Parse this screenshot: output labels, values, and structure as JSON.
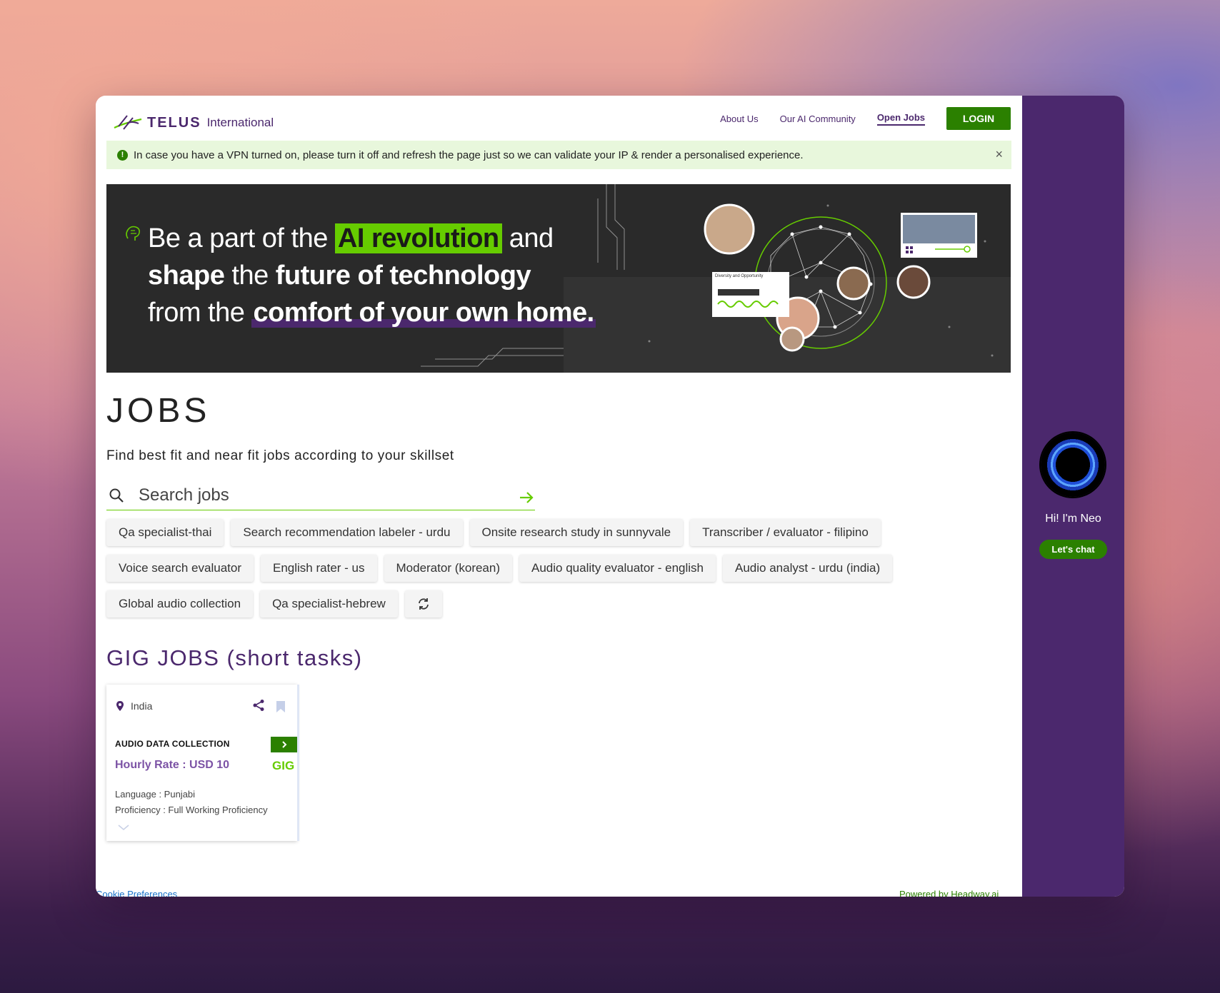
{
  "header": {
    "logo_word": "TELUS",
    "logo_sub": "International",
    "nav": [
      {
        "label": "About Us"
      },
      {
        "label": "Our AI Community"
      },
      {
        "label": "Open Jobs"
      }
    ],
    "login": "LOGIN"
  },
  "alert": {
    "text": "In case you have a VPN turned on, please turn it off and refresh the page just so we can validate your IP & render a personalised experience.",
    "icon": "!",
    "close": "×"
  },
  "banner": {
    "line1_pre": "Be a part of the ",
    "line1_hl": "AI revolution",
    "line1_post": " and",
    "line2_b1": "shape",
    "line2_mid": " the ",
    "line2_b2": "future of technology",
    "line3_pre": "from the ",
    "line3_hl": "comfort of your own home.",
    "card_label": "Diversity and Opportunity"
  },
  "jobs": {
    "title": "JOBS",
    "subtitle": "Find best fit and near fit jobs according to your skillset",
    "search_placeholder": "Search jobs",
    "chips": [
      [
        "Qa specialist-thai",
        "Search recommendation labeler - urdu",
        "Onsite research study in sunnyvale",
        "Transcriber / evaluator - filipino"
      ],
      [
        "Voice search evaluator",
        "English rater - us",
        "Moderator (korean)",
        "Audio quality evaluator - english",
        "Audio analyst - urdu (india)"
      ],
      [
        "Global audio collection",
        "Qa specialist-hebrew"
      ]
    ]
  },
  "gig": {
    "title": "GIG JOBS (short tasks)",
    "card": {
      "location": "India",
      "category": "AUDIO DATA COLLECTION",
      "rate": "Hourly Rate : USD 10",
      "tag": "GIG",
      "language": "Language : Punjabi",
      "proficiency": "Proficiency : Full Working Proficiency"
    }
  },
  "footer": {
    "cookie": "Cookie Preferences",
    "powered": "Powered by Headway.ai"
  },
  "neo": {
    "greeting": "Hi! I'm Neo",
    "chat": "Let's chat"
  },
  "colors": {
    "brand_purple": "#4b286d",
    "brand_green": "#2b8000",
    "accent_green": "#66cc00",
    "alert_bg": "#e8f7dc"
  }
}
